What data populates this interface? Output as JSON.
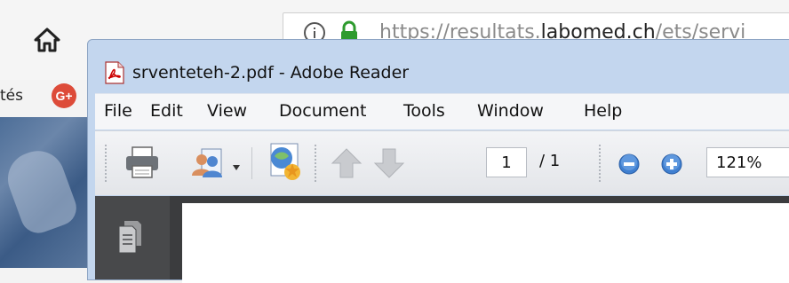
{
  "browser": {
    "url_prefix": "https://resultats.",
    "url_domain": "labomed.ch",
    "url_suffix": "/ets/servi",
    "bookmark_text": "tés",
    "gplus_label": "G+",
    "home_icon": "home-icon",
    "info_icon": "info-icon",
    "lock_icon": "lock-icon"
  },
  "reader": {
    "title": "srventeteh-2.pdf - Adobe Reader",
    "menu": [
      "File",
      "Edit",
      "View",
      "Document",
      "Tools",
      "Window",
      "Help"
    ],
    "toolbar": {
      "page_current": "1",
      "page_total": "/ 1",
      "zoom": "121%",
      "icons": [
        "print-icon",
        "share-users-icon",
        "dropdown-arrow-icon",
        "secure-icon",
        "page-up-icon",
        "page-down-icon",
        "zoom-out-icon",
        "zoom-in-icon"
      ]
    },
    "sidebar_icon": "pages-icon"
  },
  "colors": {
    "window_frame": "#c3d6ee",
    "doc_bg": "#3b3c3e",
    "accent_blue": "#2f6fc4",
    "lock_green": "#2e9b2e"
  }
}
